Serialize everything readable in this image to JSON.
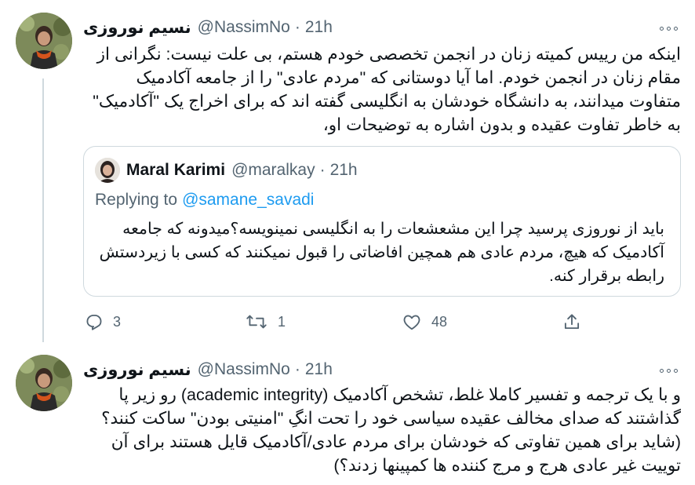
{
  "tweets": [
    {
      "author_name": "نسیم نوروزی",
      "handle": "@NassimNo",
      "separator": "·",
      "time": "21h",
      "text": "اینکه من رییس کمیته زنان در انجمن تخصصی خودم هستم، بی علت نیست: نگرانی از مقام زنان در انجمن خودم. اما آیا دوستانی که \"مردم عادی\" را از جامعه آکادمیک متفاوت میدانند، به دانشگاه خودشان به انگلیسی گفته اند که برای اخراج یک \"آکادمیک\" به خاطر تفاوت عقیده و بدون اشاره به توضیحات او،",
      "quoted": {
        "author_name": "Maral Karimi",
        "handle": "@maralkay",
        "separator": "·",
        "time": "21h",
        "replying_label": "Replying to",
        "replying_to": "@samane_savadi",
        "text": "باید از نوروزی پرسید چرا این مشعشعات را به انگلیسی نمینویسه؟میدونه که جامعه آکادمیک که هیچ، مردم عادی هم همچین افاضاتی را قبول نمیکنند که کسی با زیردستش رابطه برقرار کنه."
      },
      "actions": {
        "replies": "3",
        "retweets": "1",
        "likes": "48"
      }
    },
    {
      "author_name": "نسیم نوروزی",
      "handle": "@NassimNo",
      "separator": "·",
      "time": "21h",
      "text": "و با یک ترجمه و تفسیر کاملا غلط، تشخص آکادمیک (academic integrity) رو زیر پا گذاشتند که صدای مخالف عقیده سیاسی خود را تحت انگِ \"امنیتی بودن\" ساکت کنند؟ (شاید برای همین تفاوتی که خودشان برای مردم عادی/آکادمیک قایل هستند برای آن توییت غیر عادی هرج و مرج کننده ها کمپینها زدند؟)"
    }
  ],
  "icons": {
    "reply": "reply-icon",
    "retweet": "retweet-icon",
    "like": "heart-icon",
    "share": "share-icon",
    "more": "more-icon"
  },
  "colors": {
    "text": "#0f1419",
    "secondary": "#536471",
    "link": "#1d9bf0",
    "border": "#cfd9de"
  }
}
